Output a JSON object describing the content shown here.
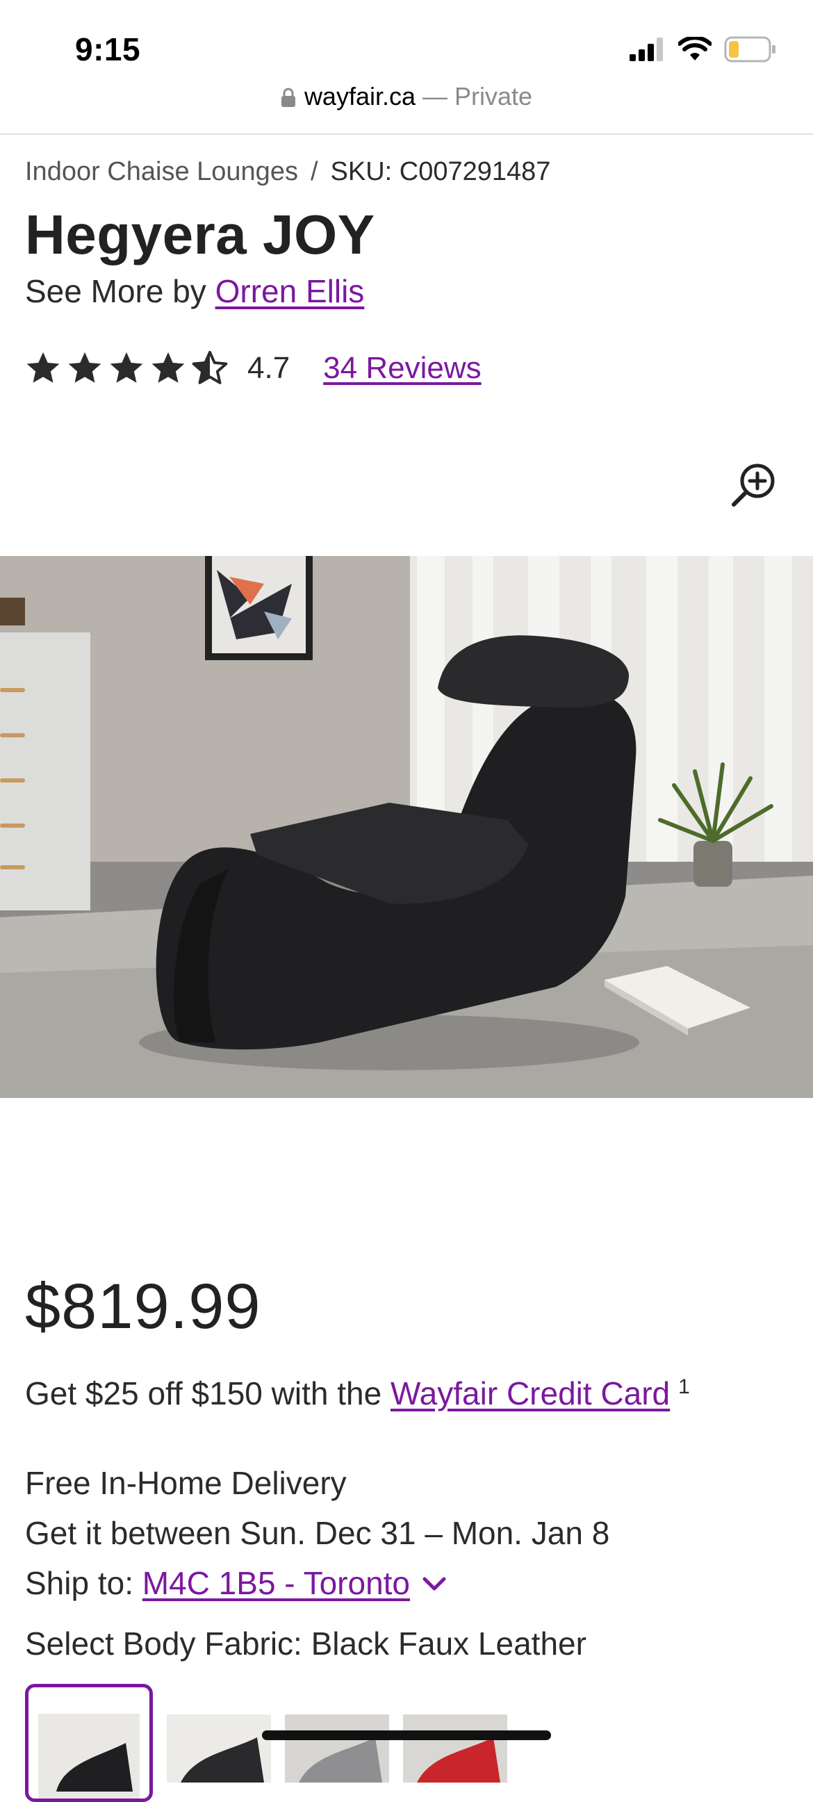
{
  "status_bar": {
    "time": "9:15"
  },
  "browser": {
    "domain": "wayfair.ca",
    "mode": " — Private"
  },
  "breadcrumb": {
    "category": "Indoor Chaise Lounges",
    "separator": "/",
    "sku": "SKU: C007291487"
  },
  "product": {
    "title": "Hegyera JOY",
    "see_more_prefix": "See More by ",
    "brand": "Orren Ellis",
    "rating": "4.7",
    "rating_stars": 4.7,
    "reviews_label": "34 Reviews",
    "price": "$819.99"
  },
  "promo": {
    "prefix": "Get $25 off $150 with the ",
    "link": "Wayfair Credit Card",
    "footnote": "1"
  },
  "delivery": {
    "line1": "Free In-Home Delivery",
    "line2": "Get it between Sun. Dec 31 – Mon. Jan 8",
    "ship_prefix": "Ship to: ",
    "ship_location": "M4C 1B5 - Toronto"
  },
  "fabric": {
    "label": "Select Body Fabric: Black Faux Leather"
  },
  "colors": {
    "link": "#7b189f",
    "text": "#2b2b2b"
  },
  "icons": [
    "lock-icon",
    "signal-icon",
    "wifi-icon",
    "battery-icon",
    "star-icon",
    "half-star-icon",
    "zoom-in-icon",
    "chevron-down-icon"
  ]
}
